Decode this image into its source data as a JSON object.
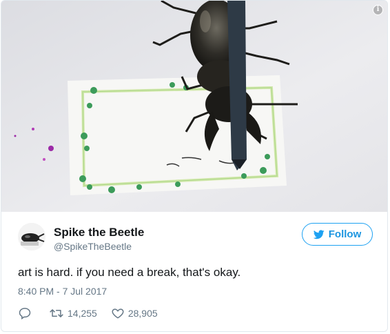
{
  "media": {
    "info_icon": "info-icon",
    "info_glyph": "i"
  },
  "author": {
    "display_name": "Spike the Beetle",
    "handle": "@SpikeTheBeetle",
    "avatar_icon": "beetle-avatar"
  },
  "follow": {
    "label": "Follow",
    "icon": "bird-icon",
    "color": "#1da1f2"
  },
  "tweet": {
    "text": "art is hard. if you need a break, that's okay.",
    "timestamp": "8:40 PM - 7 Jul 2017"
  },
  "actions": {
    "reply_icon": "reply-icon",
    "retweet_icon": "retweet-icon",
    "retweet_count": "14,255",
    "like_icon": "heart-icon",
    "like_count": "28,905"
  }
}
